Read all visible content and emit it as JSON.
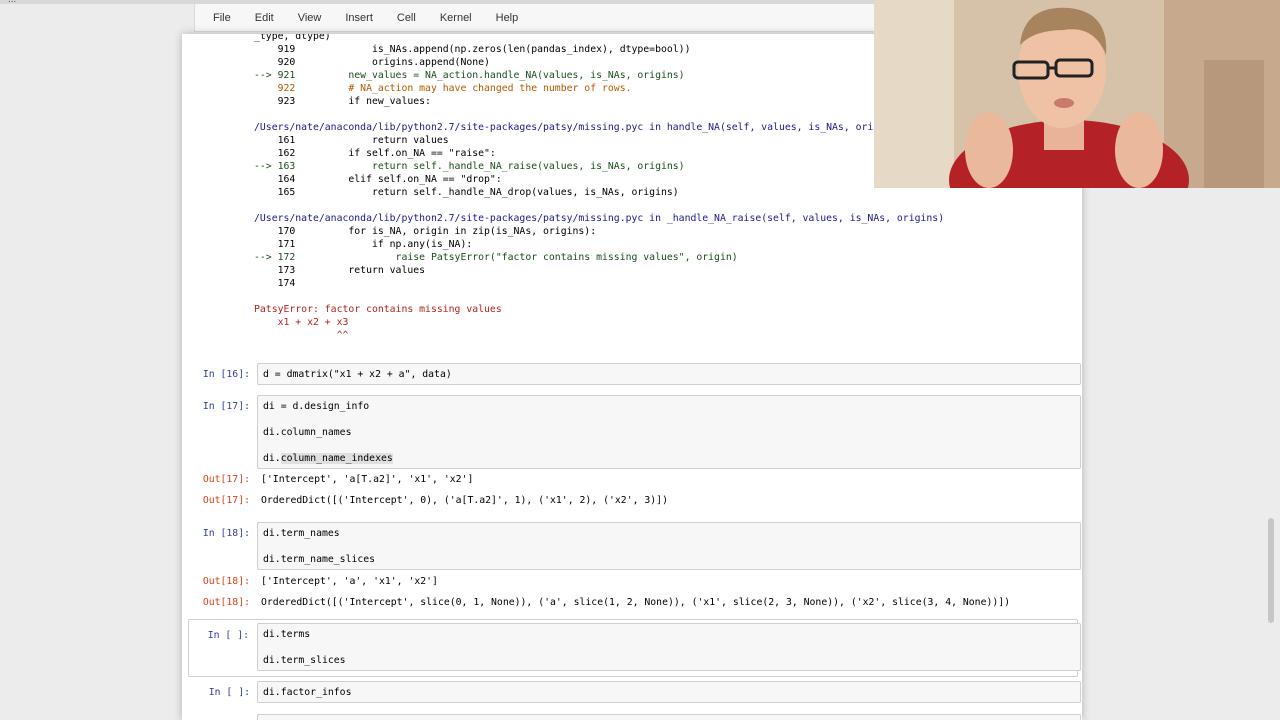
{
  "topbar": {
    "dots": "..."
  },
  "menu": [
    "File",
    "Edit",
    "View",
    "Insert",
    "Cell",
    "Kernel",
    "Help"
  ],
  "traceback": {
    "lines": [
      {
        "text": "_type, dtype)",
        "cls": ""
      },
      {
        "text": "    919             is_NAs.append(np.zeros(len(pandas_index), dtype=bool))",
        "cls": ""
      },
      {
        "text": "    920             origins.append(None)",
        "cls": ""
      },
      {
        "text": "--> 921         new_values = NA_action.handle_NA(values, is_NAs, origins)",
        "cls": "arrowline"
      },
      {
        "text": "    922         # NA_action may have changed the number of rows.",
        "cls": "comment"
      },
      {
        "text": "    923         if new_values:",
        "cls": ""
      },
      {
        "text": "",
        "cls": ""
      },
      {
        "text": "/Users/nate/anaconda/lib/python2.7/site-packages/patsy/missing.pyc in handle_NA(self, values, is_NAs, origins)",
        "cls": "path"
      },
      {
        "text": "    161             return values",
        "cls": ""
      },
      {
        "text": "    162         if self.on_NA == \"raise\":",
        "cls": ""
      },
      {
        "text": "--> 163             return self._handle_NA_raise(values, is_NAs, origins)",
        "cls": "arrowline"
      },
      {
        "text": "    164         elif self.on_NA == \"drop\":",
        "cls": ""
      },
      {
        "text": "    165             return self._handle_NA_drop(values, is_NAs, origins)",
        "cls": ""
      },
      {
        "text": "",
        "cls": ""
      },
      {
        "text": "/Users/nate/anaconda/lib/python2.7/site-packages/patsy/missing.pyc in _handle_NA_raise(self, values, is_NAs, origins)",
        "cls": "path"
      },
      {
        "text": "    170         for is_NA, origin in zip(is_NAs, origins):",
        "cls": ""
      },
      {
        "text": "    171             if np.any(is_NA):",
        "cls": ""
      },
      {
        "text": "--> 172                 raise PatsyError(\"factor contains missing values\", origin)",
        "cls": "arrowline"
      },
      {
        "text": "    173         return values",
        "cls": ""
      },
      {
        "text": "    174",
        "cls": ""
      },
      {
        "text": "",
        "cls": ""
      },
      {
        "text": "PatsyError: factor contains missing values",
        "cls": "err"
      },
      {
        "text": "    x1 + x2 + x3",
        "cls": "err"
      },
      {
        "text": "              ^^",
        "cls": "err"
      }
    ]
  },
  "cells": [
    {
      "prompt": "In [16]:",
      "code": [
        "d = dmatrix(\"x1 + x2 + a\", data)"
      ]
    },
    {
      "prompt": "In [17]:",
      "code": [
        "di = d.design_info",
        "di.column_names",
        "di.column_name_indexes"
      ],
      "outputs": [
        {
          "prompt": "Out[17]:",
          "text": "['Intercept', 'a[T.a2]', 'x1', 'x2']"
        },
        {
          "prompt": "Out[17]:",
          "text": "OrderedDict([('Intercept', 0), ('a[T.a2]', 1), ('x1', 2), ('x2', 3)])"
        }
      ]
    },
    {
      "prompt": "In [18]:",
      "code": [
        "di.term_names",
        "di.term_name_slices"
      ],
      "outputs": [
        {
          "prompt": "Out[18]:",
          "text": "['Intercept', 'a', 'x1', 'x2']"
        },
        {
          "prompt": "Out[18]:",
          "text": "OrderedDict([('Intercept', slice(0, 1, None)), ('a', slice(1, 2, None)), ('x1', slice(2, 3, None)), ('x2', slice(3, 4, None))])"
        }
      ]
    },
    {
      "prompt": "In [ ]:",
      "code": [
        "di.terms",
        "di.term_slices"
      ]
    },
    {
      "prompt": "In [ ]:",
      "code": [
        "di.factor_infos"
      ]
    }
  ]
}
